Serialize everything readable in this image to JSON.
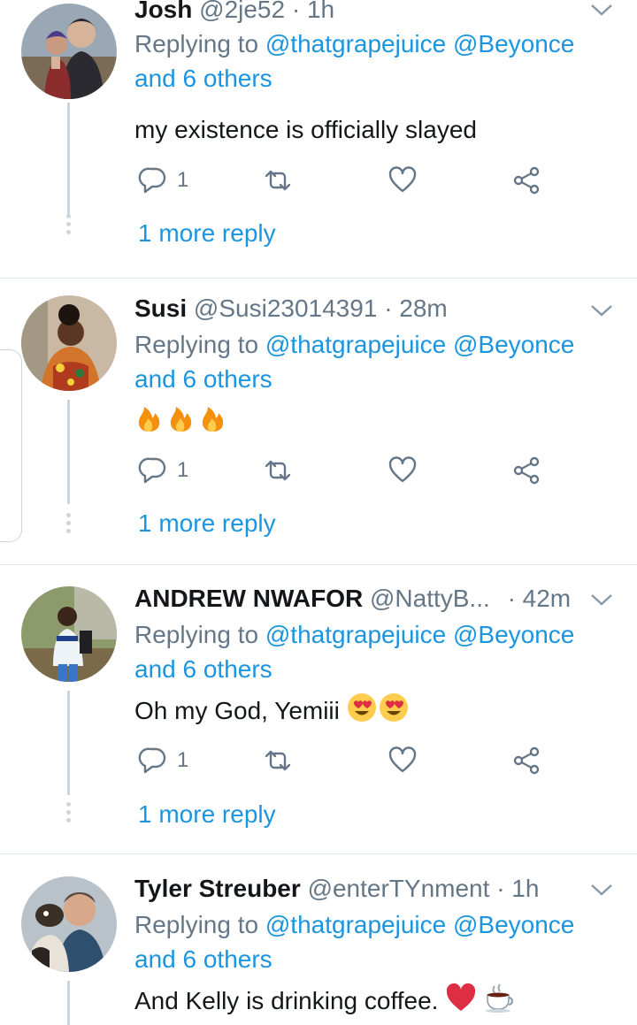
{
  "replies": [
    {
      "name": "Josh",
      "handle": "@2je52",
      "time": "· 1h",
      "replying_prefix": "Replying to",
      "mentions": "@thatgrapejuice @Beyonce",
      "others": "and 6 others",
      "text": "my existence is officially slayed",
      "reply_count": "1",
      "more_reply": "1 more reply",
      "avatar_colors": [
        "#8a6f5a",
        "#2b2a30",
        "#c9a98e"
      ]
    },
    {
      "name": "Susi",
      "handle": "@Susi23014391",
      "time": "· 28m",
      "replying_prefix": "Replying to",
      "mentions": "@thatgrapejuice @Beyonce",
      "others": "and 6 others",
      "text": "",
      "reply_count": "1",
      "more_reply": "1 more reply",
      "avatar_colors": [
        "#c8b8a4",
        "#3a2417",
        "#d2742a"
      ]
    },
    {
      "name": "ANDREW NWAFOR",
      "handle": "@NattyB...",
      "time": "· 42m",
      "replying_prefix": "Replying to",
      "mentions": "@thatgrapejuice @Beyonce",
      "others": "and 6 others",
      "text": "Oh my God, Yemiii",
      "reply_count": "1",
      "more_reply": "1 more reply",
      "avatar_colors": [
        "#7d8a5c",
        "#1f1f24",
        "#eef3f7"
      ]
    },
    {
      "name": "Tyler Streuber",
      "handle": "@enterTYnment",
      "time": "· 1h",
      "replying_prefix": "Replying to",
      "mentions": "@thatgrapejuice @Beyonce",
      "others": "and 6 others",
      "text": "And Kelly is drinking coffee.",
      "reply_count": "",
      "more_reply": "",
      "avatar_colors": [
        "#b9c1c9",
        "#5a4a3f",
        "#d9a88a"
      ]
    }
  ],
  "colors": {
    "link": "#1b95e0",
    "secondary": "#657786",
    "border": "#e1e8ed",
    "thread": "#ccd6dd"
  },
  "icons": [
    "chevron-down-icon",
    "reply-icon",
    "retweet-icon",
    "like-icon",
    "share-icon",
    "fire-emoji",
    "heart-eyes-emoji",
    "red-heart-emoji",
    "coffee-emoji"
  ]
}
